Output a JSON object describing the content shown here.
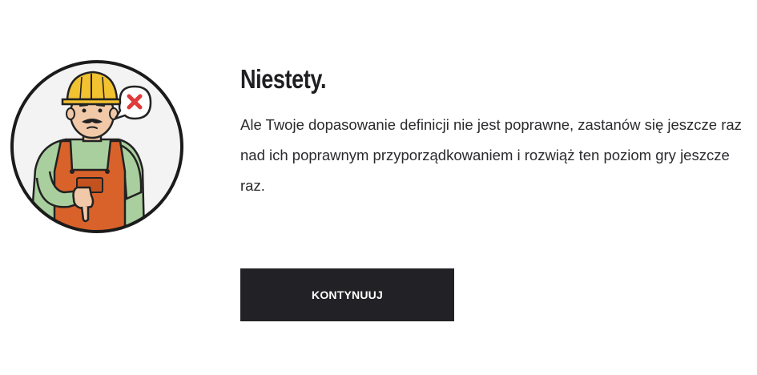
{
  "result": {
    "title": "Niestety.",
    "message": "Ale Twoje dopasowanie definicji nie jest poprawne, zastanów się jeszcze raz nad ich poprawnym przyporządkowaniem i rozwiąż ten poziom gry jeszcze raz.",
    "continue_label": "KONTYNUUJ"
  },
  "illustration": {
    "subject": "worker-thumbs-down-icon",
    "badge_icon": "red-x-icon"
  },
  "colors": {
    "button_bg": "#222226",
    "button_text": "#ffffff",
    "helmet": "#f2c230",
    "overalls": "#d9622b",
    "shirt": "#a9cf9e",
    "error_x": "#e03a3a"
  }
}
